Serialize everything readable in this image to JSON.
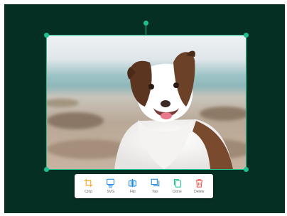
{
  "editor": {
    "background_color": "#062f24",
    "accent_color": "#1fbf8f"
  },
  "canvas_object": {
    "image_subject": "dog-photo",
    "selected": true
  },
  "toolbar": {
    "items": [
      {
        "label": "Crop",
        "icon": "crop-icon",
        "color": "#f5a623"
      },
      {
        "label": "SVG",
        "icon": "svg-icon",
        "color": "#1e88e5"
      },
      {
        "label": "Flip",
        "icon": "flip-icon",
        "color": "#1e88e5"
      },
      {
        "label": "Top",
        "icon": "bring-to-top-icon",
        "color": "#1e88e5"
      },
      {
        "label": "Clone",
        "icon": "clone-icon",
        "color": "#1fbf8f"
      },
      {
        "label": "Delete",
        "icon": "trash-icon",
        "color": "#ef5350"
      }
    ]
  }
}
